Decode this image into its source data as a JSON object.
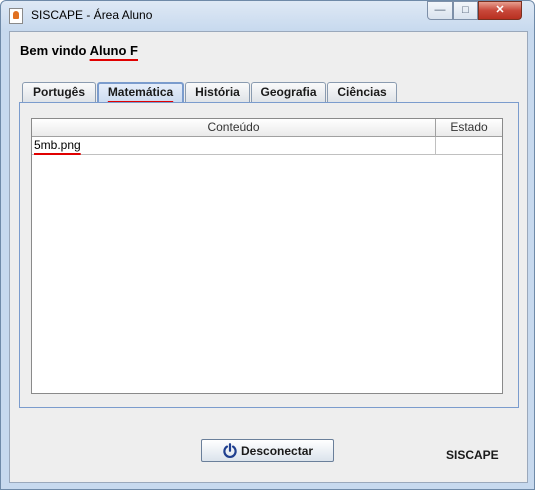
{
  "window": {
    "title": "SISCAPE - Área Aluno",
    "controls": {
      "minimize": "—",
      "maximize": "□",
      "close": "✕"
    }
  },
  "welcome": {
    "prefix": "Bem vindo",
    "user": "Aluno F"
  },
  "tabs": [
    {
      "label": "Portugês",
      "selected": false
    },
    {
      "label": "Matemática",
      "selected": true
    },
    {
      "label": "História",
      "selected": false
    },
    {
      "label": "Geografia",
      "selected": false
    },
    {
      "label": "Ciências",
      "selected": false
    }
  ],
  "table": {
    "columns": [
      "Conteúdo",
      "Estado"
    ],
    "rows": [
      {
        "conteudo": "5mb.png",
        "estado": ""
      }
    ]
  },
  "actions": {
    "disconnect_label": "Desconectar",
    "disconnect_icon": "power-icon"
  },
  "brand": "SISCAPE",
  "colors": {
    "accent_underline": "#e00000",
    "tab_selected_border": "#7b9ccd"
  }
}
